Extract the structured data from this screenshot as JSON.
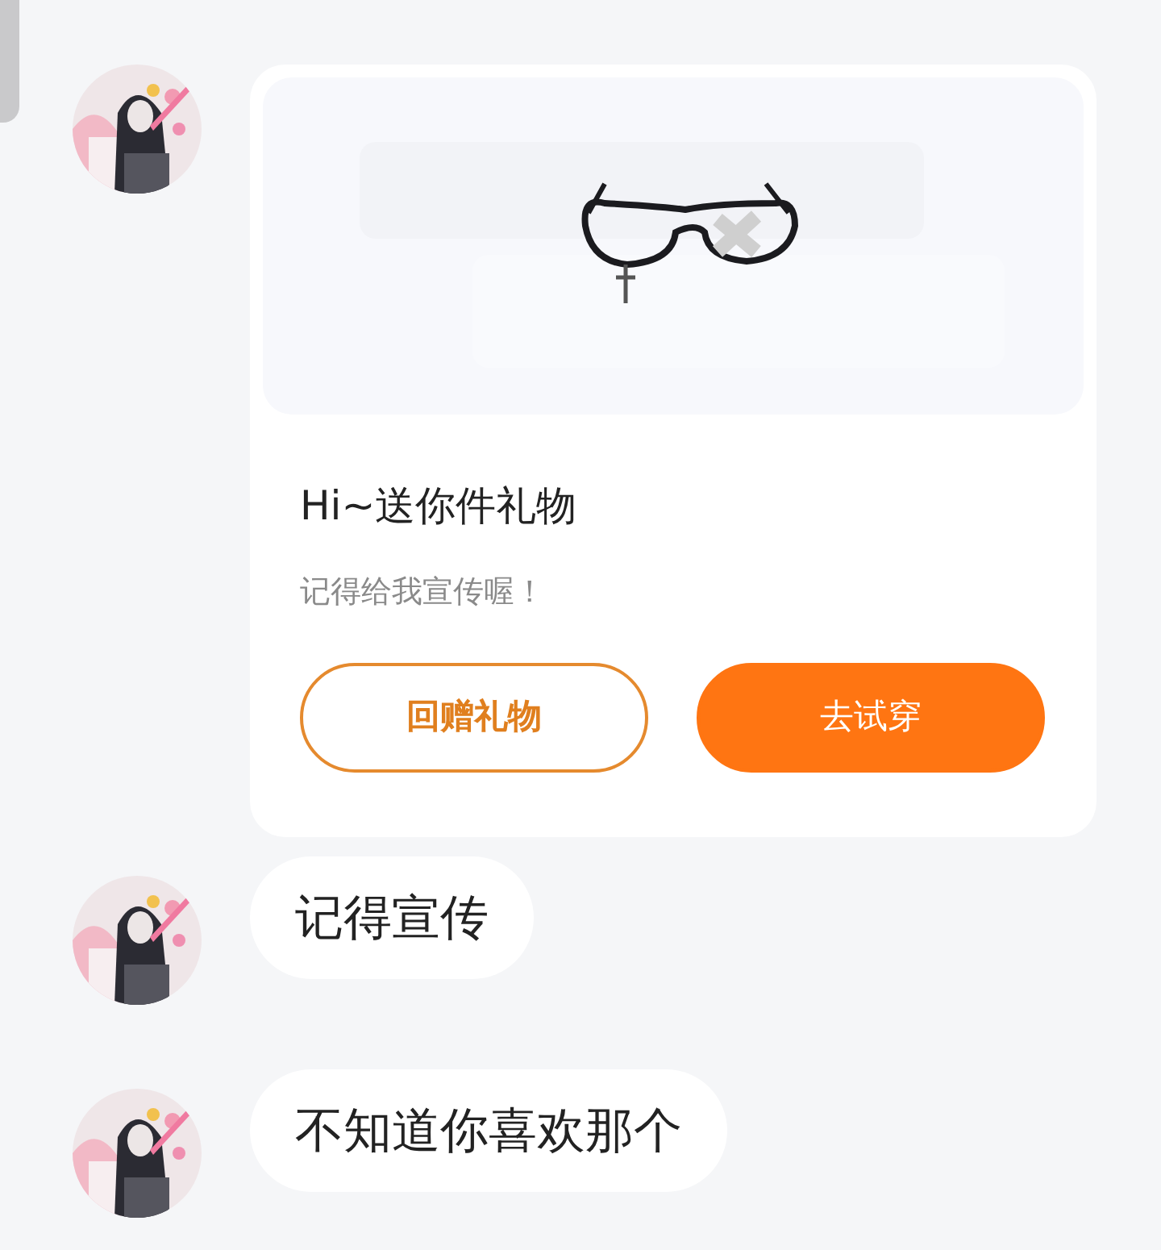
{
  "gift_card": {
    "title": "Hi~送你件礼物",
    "subtitle": "记得给我宣传喔！",
    "buttons": [
      {
        "label": "回赠礼物",
        "kind": "outline"
      },
      {
        "label": "去试穿",
        "kind": "filled"
      }
    ]
  },
  "messages": [
    {
      "text": "记得宣传"
    },
    {
      "text": "不知道你喜欢那个"
    }
  ]
}
